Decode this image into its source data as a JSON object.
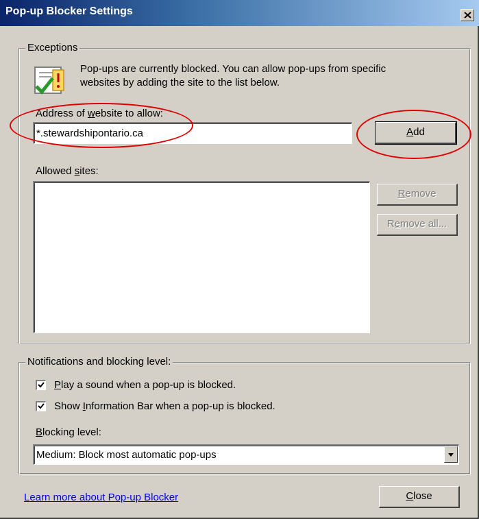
{
  "window": {
    "title": "Pop-up Blocker Settings"
  },
  "exceptions": {
    "legend": "Exceptions",
    "info_line1": "Pop-ups are currently blocked.  You can allow pop-ups from specific",
    "info_line2": "websites by adding the site to the list below.",
    "address_label": "Address of website to allow:",
    "address_value": "*.stewardshipontario.ca",
    "add_label": "Add",
    "allowed_label": "Allowed sites:",
    "remove_label": "Remove",
    "remove_all_label": "Remove all..."
  },
  "notifications": {
    "legend": "Notifications and blocking level:",
    "sound_label": "Play a sound when a pop-up is blocked.",
    "sound_checked": true,
    "infobar_label": "Show Information Bar when a pop-up is blocked.",
    "infobar_checked": true,
    "blocking_label": "Blocking level:",
    "blocking_value": "Medium: Block most automatic pop-ups"
  },
  "footer": {
    "learn_more": "Learn more about Pop-up Blocker",
    "close_label": "Close"
  },
  "annotation_color": "#e00000",
  "icons": [
    "close-icon",
    "shield-check-icon",
    "checkbox-check-icon",
    "dropdown-arrow-icon"
  ]
}
